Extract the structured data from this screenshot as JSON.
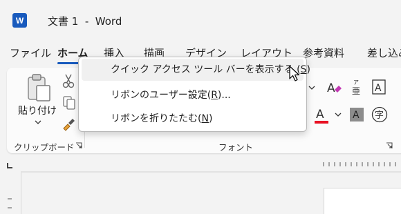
{
  "titlebar": {
    "app_icon": "word-icon",
    "app_letter": "W",
    "document_title": "文書 1  -  Word"
  },
  "tabs": [
    {
      "label": "ファイル",
      "active": false
    },
    {
      "label": "ホーム",
      "active": true
    },
    {
      "label": "挿入",
      "active": false
    },
    {
      "label": "描画",
      "active": false
    },
    {
      "label": "デザイン",
      "active": false
    },
    {
      "label": "レイアウト",
      "active": false
    },
    {
      "label": "参考資料",
      "active": false
    },
    {
      "label": "差し込み",
      "active": false
    }
  ],
  "ribbon": {
    "clipboard": {
      "paste_label": "貼り付け",
      "group_label": "クリップボード",
      "icons": [
        "clipboard-paste-icon",
        "scissors-icon",
        "copy-icon",
        "format-painter-icon",
        "dialog-launcher-icon"
      ]
    },
    "font": {
      "group_label": "フォント",
      "icons": [
        "clear-formatting-icon",
        "phonetic-guide-icon",
        "character-border-icon",
        "font-color-icon",
        "character-shading-icon",
        "enclose-characters-icon"
      ],
      "phonetic_ruby": "ア",
      "phonetic_base": "亜",
      "border_letter": "A",
      "color_letter": "A",
      "shading_letter": "A",
      "enclose_char": "字",
      "font_color_hex": "#e81123"
    }
  },
  "context_menu": {
    "items": [
      {
        "prefix": "クイック アクセス ツール バーを表示する (",
        "key": "S",
        "suffix": ")",
        "hover": true
      },
      {
        "prefix": "リボンのユーザー設定(",
        "key": "R",
        "suffix": ")...",
        "hover": false
      },
      {
        "prefix": "リボンを折りたたむ(",
        "key": "N",
        "suffix": ")",
        "hover": false
      }
    ]
  },
  "colors": {
    "accent": "#185abd",
    "background": "#f3f3f3",
    "ribbon": "#fbfbfb"
  }
}
